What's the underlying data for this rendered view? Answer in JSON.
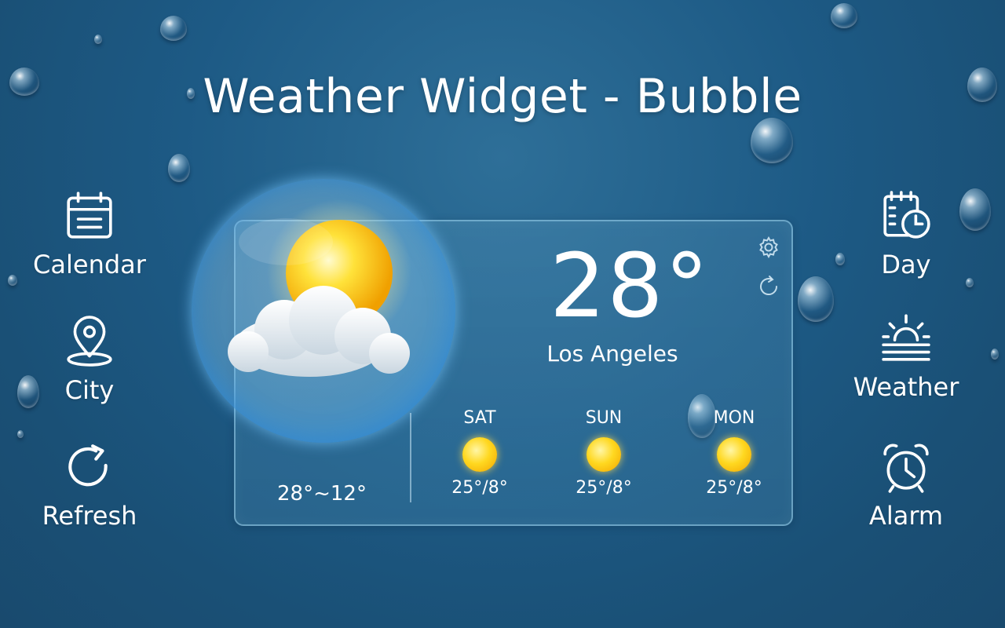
{
  "title": "Weather Widget - Bubble",
  "colors": {
    "background": "#1d5a85",
    "text": "#ffffff",
    "sun": "#ffd820"
  },
  "left_menu": [
    {
      "label": "Calendar",
      "icon": "calendar-icon"
    },
    {
      "label": "City",
      "icon": "location-pin-icon"
    },
    {
      "label": "Refresh",
      "icon": "refresh-icon"
    }
  ],
  "right_menu": [
    {
      "label": "Day",
      "icon": "calendar-clock-icon"
    },
    {
      "label": "Weather",
      "icon": "sunrise-icon"
    },
    {
      "label": "Alarm",
      "icon": "alarm-clock-icon"
    }
  ],
  "widget": {
    "temperature": "28°",
    "city": "Los Angeles",
    "range": "28°~12°",
    "condition_icon": "partly-cloudy-icon",
    "forecast": [
      {
        "day": "SAT",
        "temps": "25°/8°",
        "icon": "sun-icon"
      },
      {
        "day": "SUN",
        "temps": "25°/8°",
        "icon": "sun-icon"
      },
      {
        "day": "MON",
        "temps": "25°/8°",
        "icon": "sun-icon"
      }
    ]
  }
}
